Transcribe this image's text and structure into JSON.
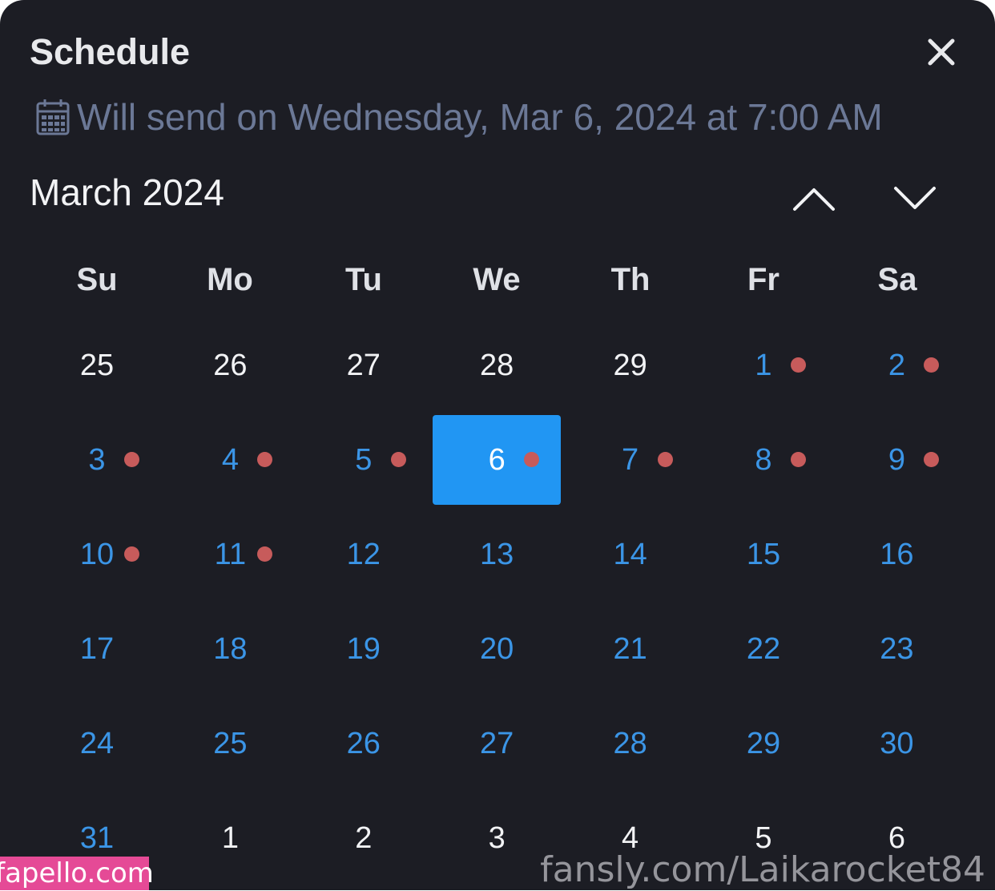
{
  "dialog": {
    "title": "Schedule",
    "close_icon": "close-icon",
    "subtitle_icon": "calendar-icon",
    "subtitle": "Will send on Wednesday, Mar 6, 2024 at 7:00 AM"
  },
  "calendar": {
    "month_label": "March 2024",
    "prev_icon": "chevron-up-icon",
    "next_icon": "chevron-down-icon",
    "weekdays": [
      "Su",
      "Mo",
      "Tu",
      "We",
      "Th",
      "Fr",
      "Sa"
    ],
    "weeks": [
      [
        {
          "label": "25",
          "state": "other",
          "dot": false
        },
        {
          "label": "26",
          "state": "other",
          "dot": false
        },
        {
          "label": "27",
          "state": "other",
          "dot": false
        },
        {
          "label": "28",
          "state": "other",
          "dot": false
        },
        {
          "label": "29",
          "state": "other",
          "dot": false
        },
        {
          "label": "1",
          "state": "current",
          "dot": true
        },
        {
          "label": "2",
          "state": "current",
          "dot": true
        }
      ],
      [
        {
          "label": "3",
          "state": "current",
          "dot": true
        },
        {
          "label": "4",
          "state": "current",
          "dot": true
        },
        {
          "label": "5",
          "state": "current",
          "dot": true
        },
        {
          "label": "6",
          "state": "selected",
          "dot": true
        },
        {
          "label": "7",
          "state": "current",
          "dot": true
        },
        {
          "label": "8",
          "state": "current",
          "dot": true
        },
        {
          "label": "9",
          "state": "current",
          "dot": true
        }
      ],
      [
        {
          "label": "10",
          "state": "current",
          "dot": true
        },
        {
          "label": "11",
          "state": "current",
          "dot": true
        },
        {
          "label": "12",
          "state": "current",
          "dot": false
        },
        {
          "label": "13",
          "state": "current",
          "dot": false
        },
        {
          "label": "14",
          "state": "current",
          "dot": false
        },
        {
          "label": "15",
          "state": "current",
          "dot": false
        },
        {
          "label": "16",
          "state": "current",
          "dot": false
        }
      ],
      [
        {
          "label": "17",
          "state": "current",
          "dot": false
        },
        {
          "label": "18",
          "state": "current",
          "dot": false
        },
        {
          "label": "19",
          "state": "current",
          "dot": false
        },
        {
          "label": "20",
          "state": "current",
          "dot": false
        },
        {
          "label": "21",
          "state": "current",
          "dot": false
        },
        {
          "label": "22",
          "state": "current",
          "dot": false
        },
        {
          "label": "23",
          "state": "current",
          "dot": false
        }
      ],
      [
        {
          "label": "24",
          "state": "current",
          "dot": false
        },
        {
          "label": "25",
          "state": "current",
          "dot": false
        },
        {
          "label": "26",
          "state": "current",
          "dot": false
        },
        {
          "label": "27",
          "state": "current",
          "dot": false
        },
        {
          "label": "28",
          "state": "current",
          "dot": false
        },
        {
          "label": "29",
          "state": "current",
          "dot": false
        },
        {
          "label": "30",
          "state": "current",
          "dot": false
        }
      ],
      [
        {
          "label": "31",
          "state": "current",
          "dot": false
        },
        {
          "label": "1",
          "state": "other",
          "dot": false
        },
        {
          "label": "2",
          "state": "other",
          "dot": false
        },
        {
          "label": "3",
          "state": "other",
          "dot": false
        },
        {
          "label": "4",
          "state": "other",
          "dot": false
        },
        {
          "label": "5",
          "state": "other",
          "dot": false
        },
        {
          "label": "6",
          "state": "other",
          "dot": false
        }
      ]
    ]
  },
  "watermarks": {
    "left": "fapello.com",
    "right": "fansly.com/Laikarocket84"
  },
  "colors": {
    "background": "#1c1d24",
    "accent": "#2196f3",
    "day_current": "#3b95e6",
    "day_other": "#f2f3f5",
    "subtitle": "#6b7896",
    "event_dot": "#c75b5b",
    "watermark_left_bg": "#e54a96"
  }
}
